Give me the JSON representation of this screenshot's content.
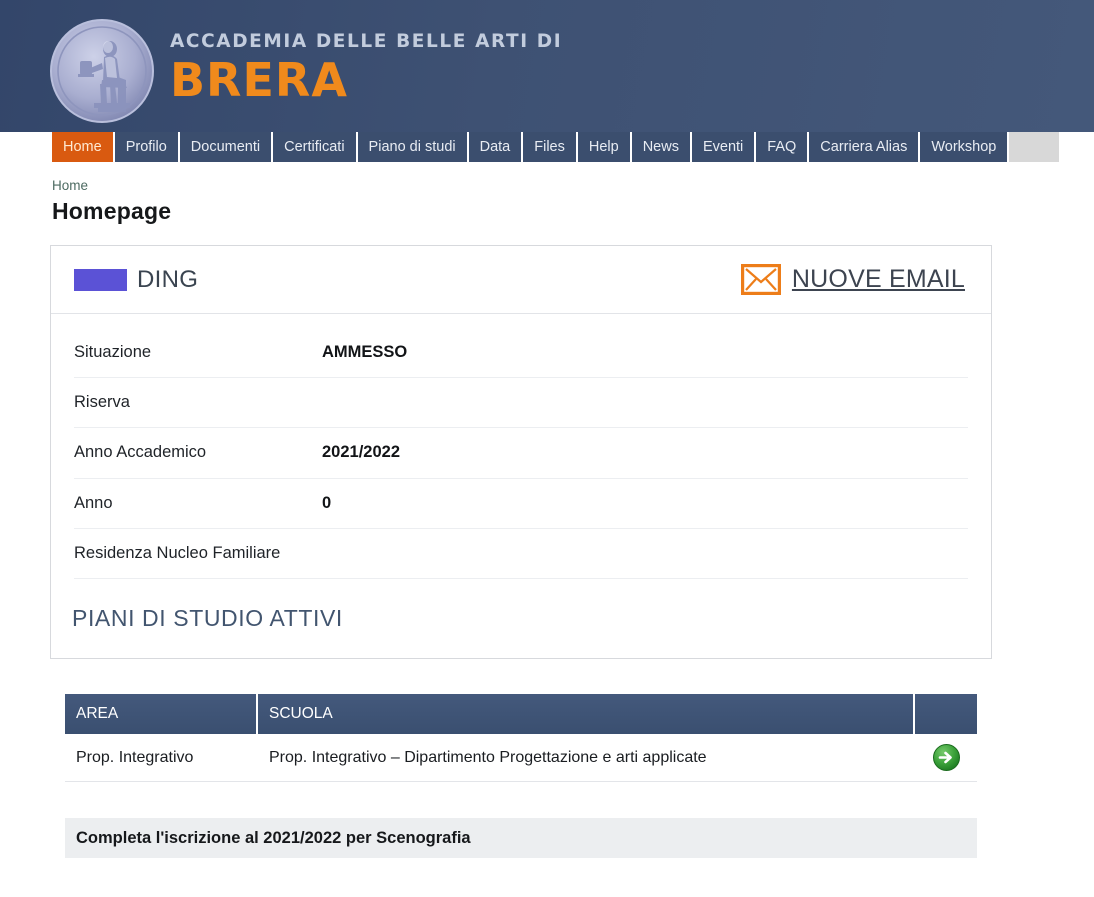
{
  "header": {
    "brand_line1": "ACCADEMIA DELLE BELLE ARTI DI",
    "brand_line2": "BRERA",
    "logo_icon": "academy-seal-icon",
    "bg_color": "#3b4e6e",
    "accent_color": "#f08a1c"
  },
  "nav": {
    "items": [
      {
        "label": "Home",
        "active": true
      },
      {
        "label": "Profilo",
        "active": false
      },
      {
        "label": "Documenti",
        "active": false
      },
      {
        "label": "Certificati",
        "active": false
      },
      {
        "label": "Piano di studi",
        "active": false
      },
      {
        "label": "Data",
        "active": false
      },
      {
        "label": "Files",
        "active": false
      },
      {
        "label": "Help",
        "active": false
      },
      {
        "label": "News",
        "active": false
      },
      {
        "label": "Eventi",
        "active": false
      },
      {
        "label": "FAQ",
        "active": false
      },
      {
        "label": "Carriera Alias",
        "active": false
      },
      {
        "label": "Workshop",
        "active": false
      }
    ],
    "active_color": "#d95a10"
  },
  "breadcrumb": {
    "label": "Home"
  },
  "page": {
    "title": "Homepage"
  },
  "card": {
    "user_name": "DING",
    "redaction_color": "#5b52d6",
    "email_link_label": "NUOVE EMAIL",
    "email_icon": "envelope-icon",
    "info_rows": [
      {
        "label": "Situazione",
        "value": "AMMESSO"
      },
      {
        "label": "Riserva",
        "value": ""
      },
      {
        "label": "Anno Accademico",
        "value": "2021/2022"
      },
      {
        "label": "Anno",
        "value": "0"
      },
      {
        "label": "Residenza Nucleo Familiare",
        "value": ""
      }
    ],
    "section_heading": "PIANI DI STUDIO ATTIVI"
  },
  "table": {
    "columns": [
      "AREA",
      "SCUOLA",
      ""
    ],
    "header_color": "#3f5578",
    "rows": [
      {
        "area": "Prop. Integrativo",
        "scuola": "Prop. Integrativo – Dipartimento Progettazione e arti applicate",
        "action_icon": "green-arrow-right-icon"
      }
    ]
  },
  "notice": {
    "text": "Completa l'iscrizione al 2021/2022 per Scenografia"
  }
}
